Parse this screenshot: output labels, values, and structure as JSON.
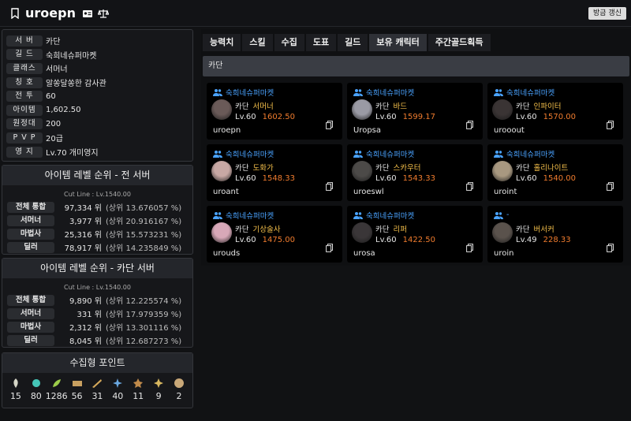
{
  "header": {
    "title": "uroepn",
    "refresh_label": "방금 갱신"
  },
  "profile": [
    {
      "label": "서 버",
      "value": "카단"
    },
    {
      "label": "길 드",
      "value": "숙희네슈퍼마켓"
    },
    {
      "label": "클래스",
      "value": "서머너"
    },
    {
      "label": "칭 호",
      "value": "알쏭달쏭한 감사관"
    },
    {
      "label": "전 투",
      "value": "60"
    },
    {
      "label": "아이템",
      "value": "1,602.50"
    },
    {
      "label": "원정대",
      "value": "200"
    },
    {
      "label": "P V P",
      "value": "20급"
    },
    {
      "label": "영 지",
      "value": "Lv.70 개미영지"
    }
  ],
  "rank_all": {
    "title": "아이템 레벨 순위 - 전 서버",
    "cutline": "Cut Line : Lv.1540.00",
    "rows": [
      {
        "label": "전체 통합",
        "rank": "97,334 위",
        "pct": "(상위 13.676057 %)"
      },
      {
        "label": "서머너",
        "rank": "3,977 위",
        "pct": "(상위 20.916167 %)"
      },
      {
        "label": "마법사",
        "rank": "25,316 위",
        "pct": "(상위 15.573231 %)"
      },
      {
        "label": "딜러",
        "rank": "78,917 위",
        "pct": "(상위 14.235849 %)"
      }
    ]
  },
  "rank_server": {
    "title": "아이템 레벨 순위 - 카단 서버",
    "cutline": "Cut Line : Lv.1540.00",
    "rows": [
      {
        "label": "전체 통합",
        "rank": "9,890 위",
        "pct": "(상위 12.225574 %)"
      },
      {
        "label": "서머너",
        "rank": "331 위",
        "pct": "(상위 17.979359 %)"
      },
      {
        "label": "마법사",
        "rank": "2,312 위",
        "pct": "(상위 13.301116 %)"
      },
      {
        "label": "딜러",
        "rank": "8,045 위",
        "pct": "(상위 12.687273 %)"
      }
    ]
  },
  "collection": {
    "title": "수집형 포인트",
    "items": [
      {
        "icon": "mokoko-seed-icon",
        "count": "15",
        "color": "#d6d6c8"
      },
      {
        "icon": "island-heart-icon",
        "count": "80",
        "color": "#45c6b8"
      },
      {
        "icon": "giant-heart-icon",
        "count": "1286",
        "color": "#9ccc4a"
      },
      {
        "icon": "art-icon",
        "count": "56",
        "color": "#c8a060"
      },
      {
        "icon": "voyage-adventure-icon",
        "count": "31",
        "color": "#d4a85a"
      },
      {
        "icon": "ignea-token-icon",
        "count": "40",
        "color": "#6aa8e0"
      },
      {
        "icon": "omnium-star-icon",
        "count": "11",
        "color": "#c08a4a"
      },
      {
        "icon": "world-tree-leaf-icon",
        "count": "9",
        "color": "#d9b860"
      },
      {
        "icon": "orpheus-star-icon",
        "count": "2",
        "color": "#c9a878"
      }
    ]
  },
  "tabs": [
    "능력치",
    "스킬",
    "수집",
    "도표",
    "길드",
    "보유 캐릭터",
    "주간골드획득"
  ],
  "server_header": "카단",
  "characters": [
    {
      "guild": "숙희네슈퍼마켓",
      "server": "카단",
      "cls": "서머너",
      "lv": "Lv.60",
      "ilvl": "1602.50",
      "name": "uroepn",
      "av": "#6a5a58"
    },
    {
      "guild": "숙희네슈퍼마켓",
      "server": "카단",
      "cls": "바드",
      "lv": "Lv.60",
      "ilvl": "1599.17",
      "name": "Uropsa",
      "av": "#9a9aa4"
    },
    {
      "guild": "숙희네슈퍼마켓",
      "server": "카단",
      "cls": "인파이터",
      "lv": "Lv.60",
      "ilvl": "1570.00",
      "name": "urooout",
      "av": "#3a3434"
    },
    {
      "guild": "숙희네슈퍼마켓",
      "server": "카단",
      "cls": "도화가",
      "lv": "Lv.60",
      "ilvl": "1548.33",
      "name": "uroant",
      "av": "#c8a8a4"
    },
    {
      "guild": "숙희네슈퍼마켓",
      "server": "카단",
      "cls": "스카우터",
      "lv": "Lv.60",
      "ilvl": "1543.33",
      "name": "uroeswl",
      "av": "#4c4a48"
    },
    {
      "guild": "숙희네슈퍼마켓",
      "server": "카단",
      "cls": "홀리나이트",
      "lv": "Lv.60",
      "ilvl": "1540.00",
      "name": "uroint",
      "av": "#a89880"
    },
    {
      "guild": "숙희네슈퍼마켓",
      "server": "카단",
      "cls": "기상술사",
      "lv": "Lv.60",
      "ilvl": "1475.00",
      "name": "urouds",
      "av": "#d8a8b8"
    },
    {
      "guild": "숙희네슈퍼마켓",
      "server": "카단",
      "cls": "리퍼",
      "lv": "Lv.60",
      "ilvl": "1422.50",
      "name": "urosa",
      "av": "#3a3638"
    },
    {
      "guild": "-",
      "server": "카단",
      "cls": "버서커",
      "lv": "Lv.49",
      "ilvl": "228.33",
      "name": "uroin",
      "av": "#5a524c"
    }
  ]
}
